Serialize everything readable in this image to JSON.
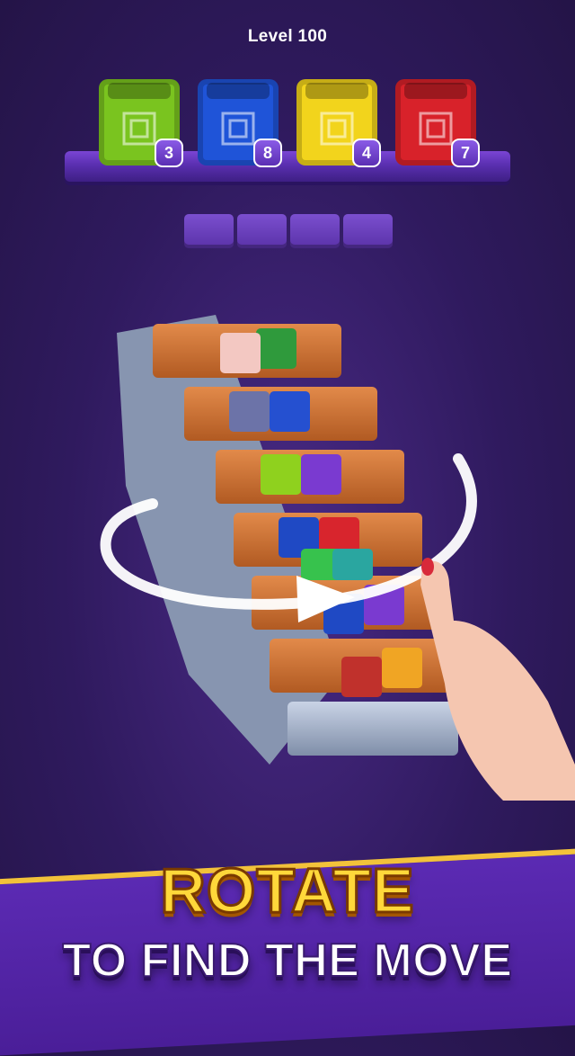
{
  "header": {
    "level_label": "Level 100"
  },
  "boxes": [
    {
      "color": "#7ac41f",
      "count": "3",
      "pattern": "square-pattern-icon"
    },
    {
      "color": "#1f54d8",
      "count": "8",
      "pattern": "snowflake-pattern-icon"
    },
    {
      "color": "#f2d41c",
      "count": "4",
      "pattern": "clover-pattern-icon"
    },
    {
      "color": "#d8222a",
      "count": "7",
      "pattern": "diamond-pattern-icon"
    }
  ],
  "slots": {
    "count": 4
  },
  "banner": {
    "title": "ROTATE",
    "subtitle": "TO FIND THE MOVE"
  },
  "colors": {
    "accent": "#ffd83a",
    "background": "#2f1a5e"
  }
}
